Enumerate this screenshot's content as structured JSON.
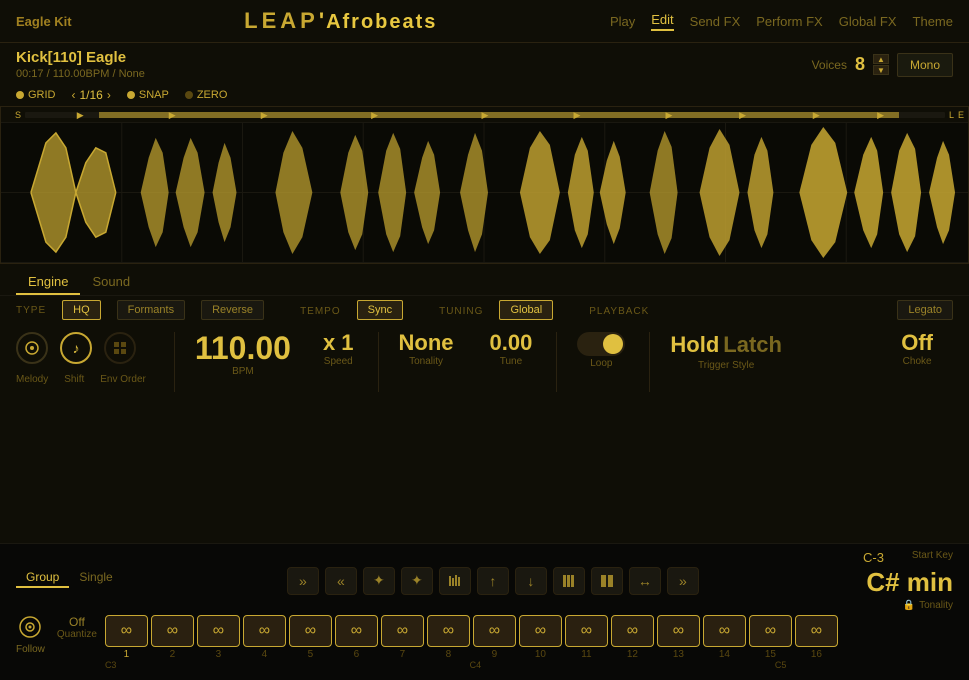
{
  "app": {
    "kit_name": "Eagle Kit",
    "title_leap": "LEAP",
    "title_separator": "'",
    "title_app": "Afrobeats"
  },
  "nav": {
    "items": [
      {
        "label": "Play",
        "active": false
      },
      {
        "label": "Edit",
        "active": true
      },
      {
        "label": "Send FX",
        "active": false
      },
      {
        "label": "Perform FX",
        "active": false
      },
      {
        "label": "Global FX",
        "active": false
      },
      {
        "label": "Theme",
        "active": false
      }
    ]
  },
  "sample": {
    "name": "Kick[110] Eagle",
    "time": "00:17",
    "bpm": "110.00BPM",
    "tonality": "None",
    "voices_label": "Voices",
    "voices_num": "8",
    "mono_label": "Mono"
  },
  "grid": {
    "grid_label": "GRID",
    "grid_value": "1/16",
    "snap_label": "SNAP",
    "zero_label": "ZERO"
  },
  "waveform": {
    "s_label": "S",
    "l_label": "L",
    "e_label": "E"
  },
  "engine": {
    "tabs": [
      "Engine",
      "Sound"
    ],
    "active_tab": 0,
    "type_label": "TYPE",
    "hq_label": "HQ",
    "formants_label": "Formants",
    "reverse_label": "Reverse",
    "tempo_label": "TEMPO",
    "sync_label": "Sync",
    "tuning_label": "TUNING",
    "global_label": "Global",
    "playback_label": "PLAYBACK",
    "legato_label": "Legato"
  },
  "controls": {
    "bpm_value": "110.00",
    "bpm_label": "BPM",
    "speed_value": "x 1",
    "speed_label": "Speed",
    "tonality_value": "None",
    "tonality_label": "Tonality",
    "tune_value": "0.00",
    "tune_label": "Tune",
    "loop_label": "Loop",
    "trigger_hold": "Hold",
    "trigger_latch": "Latch",
    "trigger_label": "Trigger Style",
    "choke_value": "Off",
    "choke_label": "Choke",
    "melody_label": "Melody",
    "shift_label": "Shift",
    "env_order_label": "Env Order"
  },
  "sequencer": {
    "group_tabs": [
      "Group",
      "Single"
    ],
    "active_group": 0,
    "start_key_label": "Start Key",
    "start_key_value": "C-3",
    "key_display": "C# min",
    "tonality_label": "Tonality",
    "follow_label": "Follow",
    "quantize_value": "Off",
    "quantize_label": "Quantize",
    "steps": [
      1,
      2,
      3,
      4,
      5,
      6,
      7,
      8,
      9,
      10,
      11,
      12,
      13,
      14,
      15,
      16
    ],
    "key_markers": [
      "C3",
      "C4",
      "C5"
    ]
  }
}
